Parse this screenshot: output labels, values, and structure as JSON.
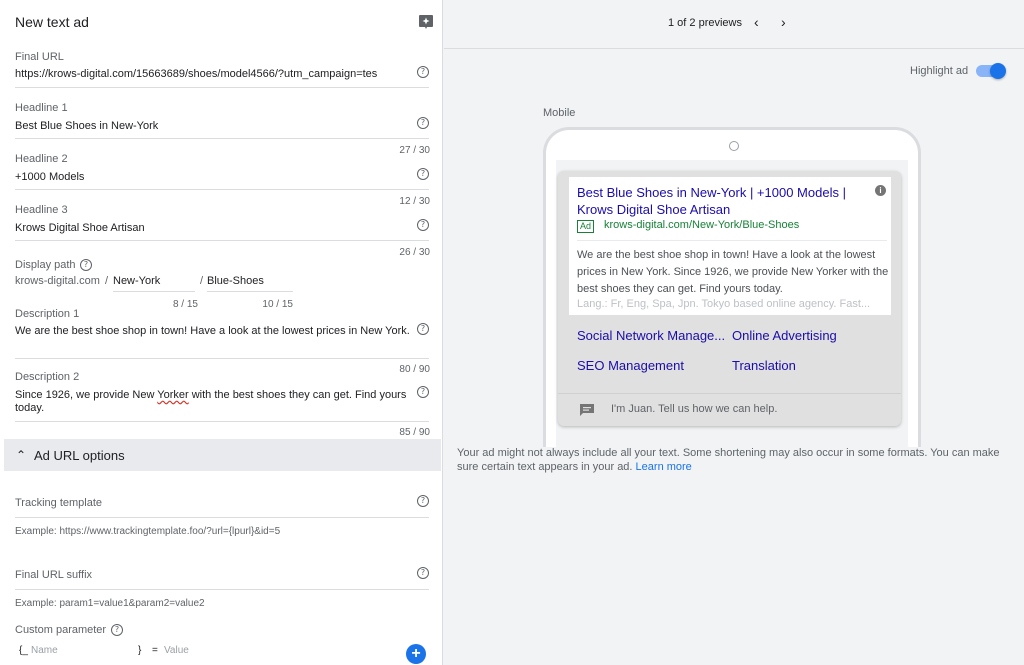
{
  "form": {
    "title": "New text ad",
    "final_url": {
      "label": "Final URL",
      "value": "https://krows-digital.com/15663689/shoes/model4566/?utm_campaign=tes"
    },
    "headline1": {
      "label": "Headline 1",
      "value": "Best Blue Shoes in New-York",
      "count": "27 / 30"
    },
    "headline2": {
      "label": "Headline 2",
      "value": "+1000 Models",
      "count": "12 / 30"
    },
    "headline3": {
      "label": "Headline 3",
      "value": "Krows Digital Shoe Artisan",
      "count": "26 / 30"
    },
    "display_path": {
      "label": "Display path",
      "domain": "krows-digital.com",
      "sep1": "/",
      "path1": "New-York",
      "sep2": "/",
      "path2": "Blue-Shoes",
      "count1": "8 / 15",
      "count2": "10 / 15"
    },
    "description1": {
      "label": "Description 1",
      "value": "We are the best shoe shop in town! Have a look at the lowest prices in New York.",
      "count": "80 / 90"
    },
    "description2": {
      "label": "Description 2",
      "value_before": "Since 1926, we provide New ",
      "value_misspelled": "Yorker",
      "value_after": " with the best shoes they can get. Find yours",
      "value_line2": "today.",
      "count": "85 / 90"
    },
    "url_options": {
      "title": "Ad URL options",
      "tracking_template": {
        "label": "Tracking template",
        "example": "Example: https://www.trackingtemplate.foo/?url={lpurl}&id=5"
      },
      "final_url_suffix": {
        "label": "Final URL suffix",
        "example": "Example: param1=value1&param2=value2"
      },
      "custom_parameter": {
        "label": "Custom parameter",
        "open_brace": "{_",
        "name_placeholder": "Name",
        "close_brace": "}",
        "equals": "=",
        "value_placeholder": "Value"
      }
    },
    "add_symbol": "+"
  },
  "preview": {
    "counter": "1 of 2 previews",
    "prev_glyph": "‹",
    "next_glyph": "›",
    "highlight_label": "Highlight ad",
    "highlight_on": true,
    "device_label": "Mobile",
    "ad": {
      "headline": "Best Blue Shoes in New-York | +1000 Models | Krows Digital Shoe Artisan",
      "info_glyph": "i",
      "badge": "Ad",
      "display_url": "krows-digital.com/New-York/Blue-Shoes",
      "description": "We are the best shoe shop in town! Have a look at the lowest prices in New York. Since 1926, we provide New Yorker with the best shoes they can get. Find yours today.",
      "extension": "Lang.: Fr, Eng, Spa, Jpn. Tokyo based online agency. Fast...",
      "sitelinks": [
        "Social Network Manage...",
        "Online Advertising",
        "SEO Management",
        "Translation"
      ],
      "message": "I'm Juan. Tell us how we can help."
    },
    "disclaimer": "Your ad might not always include all your text. Some shortening may also occur in some formats. You can make sure certain text appears in your ad.",
    "learn_more": "Learn more"
  },
  "colors": {
    "accent": "#1a73e8",
    "link": "#1a0dab",
    "url_green": "#188038"
  }
}
